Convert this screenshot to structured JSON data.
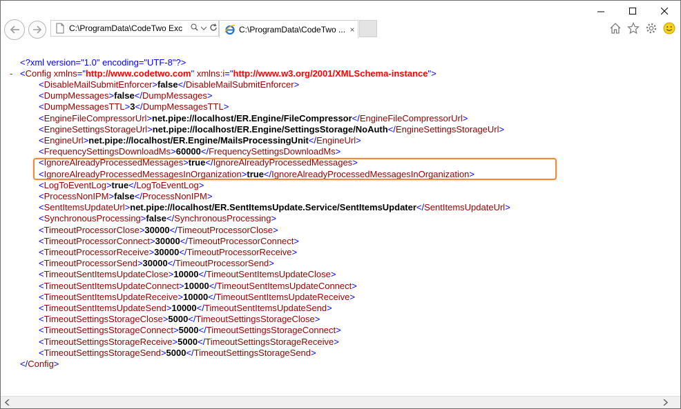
{
  "browser": {
    "address_text": "C:\\ProgramData\\CodeTwo Exc",
    "tab_title": "C:\\ProgramData\\CodeTwo ...",
    "tab_close": "×",
    "caption": {
      "minimize": "—",
      "maximize": "☐",
      "close": "✕"
    }
  },
  "xml": {
    "declaration": "<?xml version=\"1.0\" encoding=\"UTF-8\"?>",
    "collapse_marker": "-",
    "root": {
      "name": "Config",
      "attr1_name": "xmlns",
      "attr1_value": "http://www.codetwo.com",
      "attr2_name": "xmlns:i",
      "attr2_value": "http://www.w3.org/2001/XMLSchema-instance"
    },
    "elements": [
      {
        "name": "DisableMailSubmitEnforcer",
        "value": "false"
      },
      {
        "name": "DumpMessages",
        "value": "false"
      },
      {
        "name": "DumpMessagesTTL",
        "value": "3"
      },
      {
        "name": "EngineFileCompressorUrl",
        "value": "net.pipe://localhost/ER.Engine/FileCompressor"
      },
      {
        "name": "EngineSettingsStorageUrl",
        "value": "net.pipe://localhost/ER.Engine/SettingsStorage/NoAuth"
      },
      {
        "name": "EngineUrl",
        "value": "net.pipe://localhost/ER.Engine/MailsProcessingUnit"
      },
      {
        "name": "FrequencySettingsDownloadMs",
        "value": "60000"
      },
      {
        "name": "IgnoreAlreadyProcessedMessages",
        "value": "true"
      },
      {
        "name": "IgnoreAlreadyProcessedMessagesInOrganization",
        "value": "true"
      },
      {
        "name": "LogToEventLog",
        "value": "true"
      },
      {
        "name": "ProcessNonIPM",
        "value": "false"
      },
      {
        "name": "SentItemsUpdateUrl",
        "value": "net.pipe://localhost/ER.SentItemsUpdate.Service/SentItemsUpdater"
      },
      {
        "name": "SynchronousProcessing",
        "value": "false"
      },
      {
        "name": "TimeoutProcessorClose",
        "value": "30000"
      },
      {
        "name": "TimeoutProcessorConnect",
        "value": "30000"
      },
      {
        "name": "TimeoutProcessorReceive",
        "value": "30000"
      },
      {
        "name": "TimeoutProcessorSend",
        "value": "30000"
      },
      {
        "name": "TimeoutSentItemsUpdateClose",
        "value": "10000"
      },
      {
        "name": "TimeoutSentItemsUpdateConnect",
        "value": "10000"
      },
      {
        "name": "TimeoutSentItemsUpdateReceive",
        "value": "10000"
      },
      {
        "name": "TimeoutSentItemsUpdateSend",
        "value": "10000"
      },
      {
        "name": "TimeoutSettingsStorageClose",
        "value": "5000"
      },
      {
        "name": "TimeoutSettingsStorageConnect",
        "value": "5000"
      },
      {
        "name": "TimeoutSettingsStorageReceive",
        "value": "5000"
      },
      {
        "name": "TimeoutSettingsStorageSend",
        "value": "5000"
      }
    ]
  },
  "colors": {
    "tag": "#0000ff",
    "element_name": "#990000",
    "attr_value": "#ff0000",
    "highlight": "#f08a3a"
  },
  "icons": [
    "back-arrow-icon",
    "forward-arrow-icon",
    "page-icon",
    "search-icon",
    "refresh-icon",
    "ie-icon",
    "home-icon",
    "favorites-star-icon",
    "settings-gear-icon",
    "smiley-feedback-icon"
  ]
}
